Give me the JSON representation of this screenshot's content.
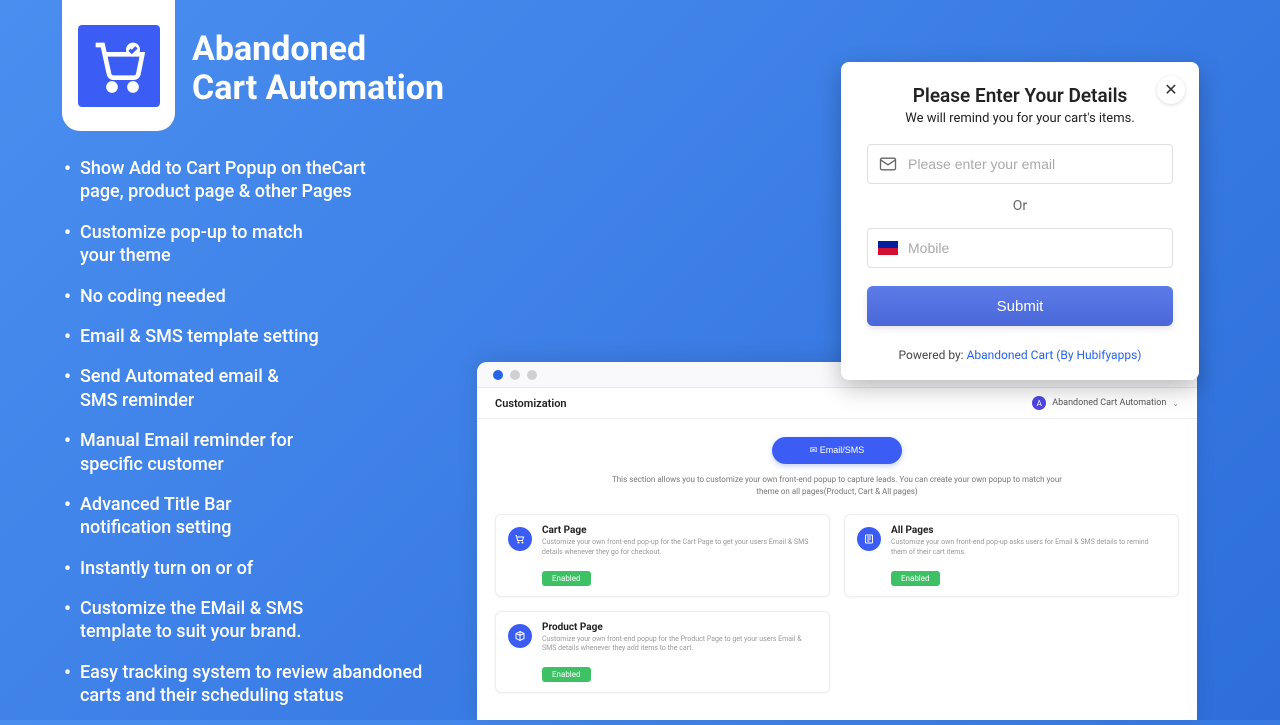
{
  "title": {
    "line1": "Abandoned",
    "line2": "Cart Automation"
  },
  "bullets": [
    "Show Add to Cart Popup on theCart page, product page & other Pages",
    "Customize pop-up to match your theme",
    "No coding needed",
    "Email & SMS template setting",
    "Send Automated email & SMS reminder",
    "Manual Email reminder for specific customer",
    "Advanced Title Bar notification setting",
    "Instantly turn on or of",
    "Customize the EMail & SMS template to suit your brand.",
    "Easy tracking system to review abandoned carts and their scheduling status"
  ],
  "modal": {
    "title": "Please Enter Your Details",
    "subtitle": "We will remind you for your cart's items.",
    "email_placeholder": "Please enter your email",
    "or": "Or",
    "mobile_placeholder": "Mobile",
    "submit": "Submit",
    "powered_prefix": "Powered by: ",
    "powered_link": "Abandoned Cart (By Hubifyapps)"
  },
  "app": {
    "header_title": "Customization",
    "account_name": "Abandoned Cart Automation",
    "pill": "✉ Email/SMS",
    "section_desc": "This section allows you to customize your own front‑end popup to capture leads. You can create your own popup to match your theme on all pages(Product, Cart & All pages)",
    "cards": [
      {
        "title": "Cart Page",
        "desc": "Customize your own front‑end pop‑up for the Cart Page to get your users Email & SMS details whenever they go for checkout.",
        "badge": "Enabled"
      },
      {
        "title": "All Pages",
        "desc": "Customize your own front‑end pop‑up asks users for Email & SMS details to remind them of their cart items.",
        "badge": "Enabled"
      },
      {
        "title": "Product Page",
        "desc": "Customize your own front‑end popup for the Product Page to get your users Email & SMS details whenever they add items to the cart.",
        "badge": "Enabled"
      }
    ]
  }
}
